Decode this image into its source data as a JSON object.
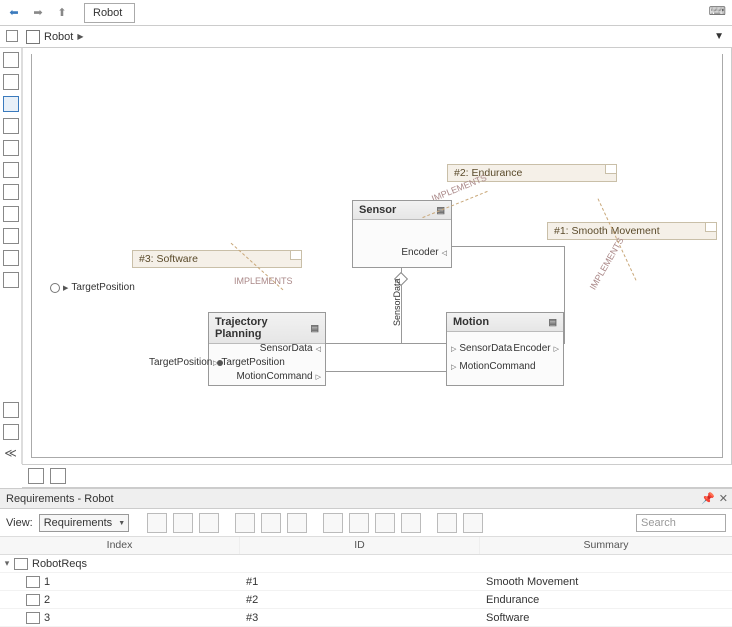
{
  "tab": {
    "title": "Robot"
  },
  "breadcrumb": {
    "text": "Robot"
  },
  "title": "Robot",
  "blocks": {
    "sensor": {
      "title": "Sensor",
      "port_encoder": "Encoder"
    },
    "trajectory": {
      "title": "Trajectory Planning",
      "port_sensordata": "SensorData",
      "port_target": "TargetPosition",
      "port_motioncmd": "MotionCommand"
    },
    "motion": {
      "title": "Motion",
      "port_sensordata": "SensorData",
      "port_motioncmd": "MotionCommand",
      "port_encoder": "Encoder"
    },
    "ext_target": "TargetPosition",
    "ext_target_in": "TargetPosition",
    "sensordata_label": "SensorData"
  },
  "reqs": {
    "flag1": "#1: Smooth Movement",
    "flag2": "#2: Endurance",
    "flag3": "#3: Software",
    "implements": "IMPLEMENTS"
  },
  "panel": {
    "title": "Requirements - Robot",
    "view_label": "View:",
    "view_value": "Requirements",
    "search_placeholder": "Search",
    "cols": {
      "idx": "Index",
      "id": "ID",
      "sum": "Summary"
    },
    "root": "RobotReqs",
    "rows": [
      {
        "idx": "1",
        "id": "#1",
        "sum": "Smooth Movement"
      },
      {
        "idx": "2",
        "id": "#2",
        "sum": "Endurance"
      },
      {
        "idx": "3",
        "id": "#3",
        "sum": "Software"
      }
    ]
  }
}
